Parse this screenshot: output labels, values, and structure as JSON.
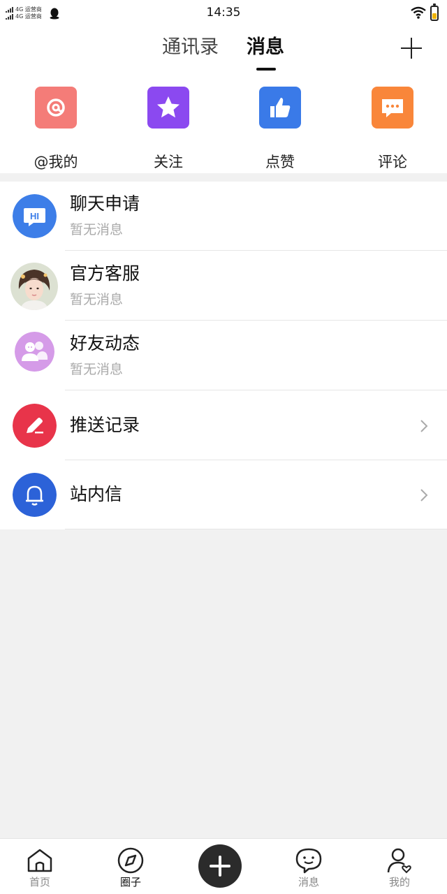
{
  "status_bar": {
    "carrier_line1": "4G 运营商",
    "carrier_line2": "4G 运营商",
    "time": "14:35",
    "battery_color": "#f0b400"
  },
  "header": {
    "tabs": [
      {
        "label": "通讯录",
        "active": false
      },
      {
        "label": "消息",
        "active": true
      }
    ],
    "add_icon": "plus-icon"
  },
  "quick_actions": [
    {
      "label": "@我的",
      "icon": "at-icon",
      "color": "#f47c78"
    },
    {
      "label": "关注",
      "icon": "star-icon",
      "color": "#8b49f0"
    },
    {
      "label": "点赞",
      "icon": "thumbs-up-icon",
      "color": "#3a7ae8"
    },
    {
      "label": "评论",
      "icon": "comment-icon",
      "color": "#f9863a"
    }
  ],
  "list": [
    {
      "title": "聊天申请",
      "subtitle": "暂无消息",
      "icon": "hi-chat-icon",
      "color": "#3d7ee8"
    },
    {
      "title": "官方客服",
      "subtitle": "暂无消息",
      "icon": "user-avatar-photo"
    },
    {
      "title": "好友动态",
      "subtitle": "暂无消息",
      "icon": "friends-icon",
      "color": "#d59be8"
    },
    {
      "title": "推送记录",
      "icon": "edit-icon",
      "color": "#e8344a",
      "has_chevron": true
    },
    {
      "title": "站内信",
      "icon": "bell-icon",
      "color": "#2c62d8",
      "has_chevron": true
    }
  ],
  "bottom_nav": [
    {
      "label": "首页",
      "icon": "home-icon",
      "active": false
    },
    {
      "label": "圈子",
      "icon": "compass-icon",
      "active": true
    },
    {
      "label": "",
      "icon": "add-center-icon"
    },
    {
      "label": "消息",
      "icon": "chat-bubble-icon",
      "active": false
    },
    {
      "label": "我的",
      "icon": "profile-icon",
      "active": false
    }
  ]
}
